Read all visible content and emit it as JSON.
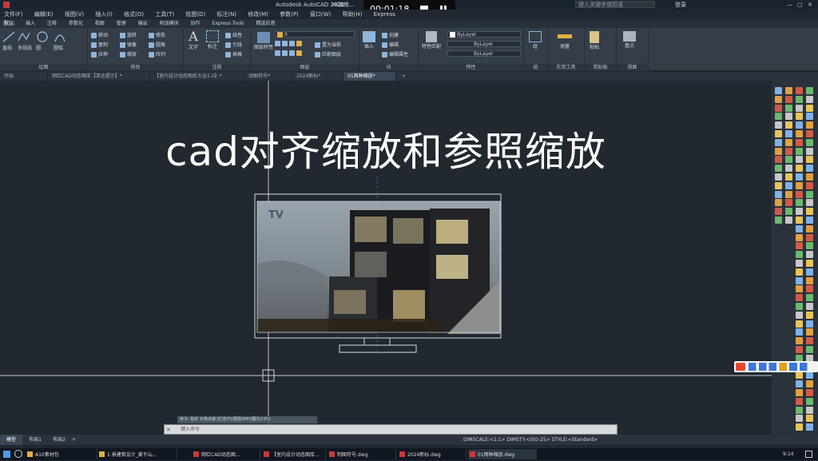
{
  "window": {
    "title": "Autodesk AutoCAD 2022",
    "title_suffix": "Hi演练...",
    "search_placeholder": "键入关键字或短语",
    "user": "登录"
  },
  "video": {
    "time": "00:01:18"
  },
  "menu": [
    "文件(F)",
    "编辑(E)",
    "视图(V)",
    "插入(I)",
    "格式(O)",
    "工具(T)",
    "绘图(D)",
    "标注(N)",
    "修改(M)",
    "参数(P)",
    "窗口(W)",
    "帮助(H)",
    "Express"
  ],
  "ribbon_tabs": [
    "默认",
    "插入",
    "注释",
    "参数化",
    "视图",
    "管理",
    "输出",
    "附加模块",
    "协作",
    "Express Tools",
    "精选应用"
  ],
  "ribbon": {
    "draw": {
      "title": "绘图",
      "line": "直线",
      "polyline": "多段线",
      "circle": "圆",
      "arc": "圆弧"
    },
    "modify": {
      "title": "修改",
      "move": "移动",
      "rotate": "旋转",
      "trim": "修剪",
      "copy": "复制",
      "mirror": "镜像",
      "fillet": "圆角",
      "stretch": "拉伸",
      "scale": "缩放",
      "array": "阵列"
    },
    "annotation": {
      "title": "注释",
      "text": "文字",
      "dimension": "标注",
      "linear": "线性",
      "leader": "引线",
      "table": "表格"
    },
    "layers": {
      "title": "图层",
      "props": "图层特性",
      "current": "0",
      "make_current": "置为当前",
      "match": "匹配图层"
    },
    "block": {
      "title": "块",
      "insert": "插入",
      "create": "创建",
      "edit": "编辑",
      "attr": "编辑属性"
    },
    "properties": {
      "title": "特性",
      "match": "特性匹配",
      "bylayer1": "ByLayer",
      "bylayer2": "ByLayer",
      "bylayer3": "ByLayer"
    },
    "groups": {
      "title": "组",
      "group": "组"
    },
    "utilities": {
      "title": "实用工具",
      "measure": "测量"
    },
    "clipboard": {
      "title": "剪贴板",
      "paste": "粘贴"
    },
    "view": {
      "title": "视图",
      "base": "基点"
    }
  },
  "doc_tabs": [
    "开始",
    "网红CAD动态图库【亚达提示】*",
    "【室内设计动态图库大全2.0】*",
    "动图符号*",
    "2024新标*",
    "01两种缩放*"
  ],
  "headline": "cad对齐缩放和参照缩放",
  "drawing": {
    "tv_label": "TV"
  },
  "command": {
    "history": "命令: 指定 对角点或 [栏选(F)/圈围(WP)/圈交(CP)]:",
    "placeholder": "键入命令"
  },
  "layout_tabs": [
    "模型",
    "布局1",
    "布局2"
  ],
  "status_text": "DIMSCALE:<1:1> DIMSTY:<ISO-25> STYLE:<Standard>",
  "taskbar": [
    {
      "label": "A10素材包"
    },
    {
      "label": "1.景建筑设计_黄干山..."
    },
    {
      "label": "网红CAD动态图..."
    },
    {
      "label": "【室内设计动态图库..."
    },
    {
      "label": "制图符号.dwg"
    },
    {
      "label": "2024新标.dwg"
    },
    {
      "label": "01两种缩放.dwg"
    }
  ],
  "clock": "9:14"
}
